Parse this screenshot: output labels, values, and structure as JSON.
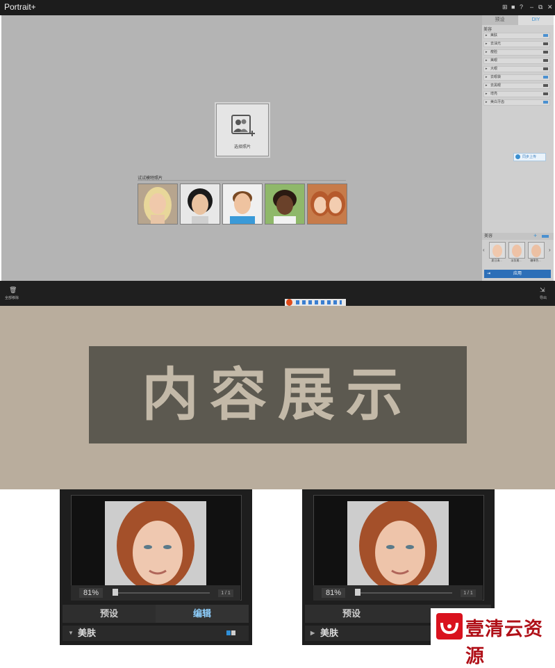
{
  "app": {
    "title": "Portrait+",
    "window_controls": [
      "⊞",
      "■",
      "?",
      "–",
      "⧉",
      "✕"
    ]
  },
  "canvas": {
    "upload_label": "选择照片",
    "try_label": "试试模特照片",
    "model_count": 5
  },
  "panel": {
    "tabs": [
      "预设",
      "DIY"
    ],
    "active_tab": "DIY",
    "feature_header": "美容",
    "features": [
      {
        "label": "美肤",
        "on": true
      },
      {
        "label": "去油光",
        "on": false
      },
      {
        "label": "瘦脸",
        "on": false
      },
      {
        "label": "美眼",
        "on": false
      },
      {
        "label": "大眼",
        "on": false
      },
      {
        "label": "去眼袋",
        "on": true
      },
      {
        "label": "去黑眼",
        "on": false
      },
      {
        "label": "增亮",
        "on": false
      },
      {
        "label": "美白牙齿",
        "on": true
      }
    ],
    "share_label": "同步上传",
    "looks_label": "美容",
    "looks": [
      "夏日清...",
      "淡妆美...",
      "糖果色..."
    ],
    "apply_label": "应用"
  },
  "bottom_bar": {
    "left_label": "全部移除",
    "right_label": "导出"
  },
  "banner": {
    "title": "内容展示"
  },
  "editor_left": {
    "zoom": "81%",
    "page": "1 / 1",
    "tab_preset": "预设",
    "tab_edit": "编辑",
    "active_tab": "编辑",
    "section": "美肤",
    "section_expanded": true
  },
  "editor_right": {
    "zoom": "81%",
    "page": "1 / 1",
    "tab_preset": "预设",
    "section": "美肤",
    "section_expanded": false
  },
  "watermark": {
    "text": "壹清云资源"
  },
  "colors": {
    "accent": "#3a8fd0",
    "banner_bg": "#b9ad9d",
    "banner_box": "#5c5950",
    "logo_red": "#d9121e"
  }
}
